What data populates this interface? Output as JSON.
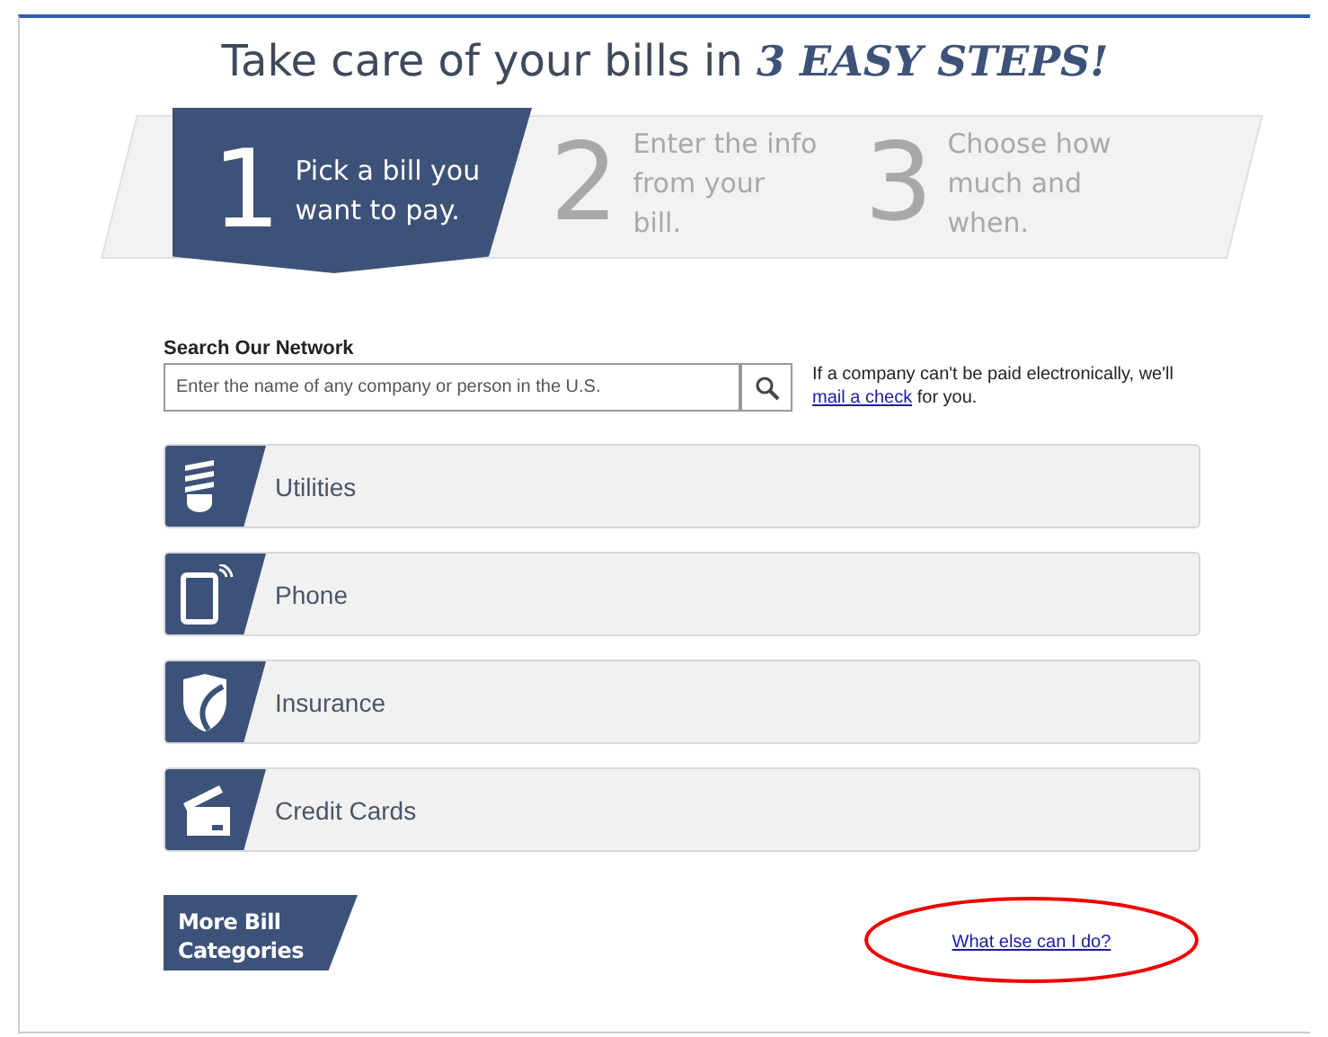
{
  "heading": {
    "text": "Take care of your bills in",
    "highlight": "3 EASY STEPS!"
  },
  "steps": [
    {
      "number": "1",
      "text": "Pick a bill you want to pay.",
      "selected": true
    },
    {
      "number": "2",
      "text": "Enter the info from your bill.",
      "selected": false
    },
    {
      "number": "3",
      "text": "Choose how much and when.",
      "selected": false
    }
  ],
  "search": {
    "label": "Search Our Network",
    "placeholder": "Enter the name of any company or person in the U.S."
  },
  "note": {
    "text": "If a company can't be paid electronically, we'll",
    "link": "mail a check",
    "after": "for you."
  },
  "categories": [
    {
      "label": "Utilities",
      "kind": "bulb"
    },
    {
      "label": "Phone",
      "kind": "tablet"
    },
    {
      "label": "Insurance",
      "kind": "shield"
    },
    {
      "label": "Credit Cards",
      "kind": "card"
    }
  ],
  "more_button": "More Bill Categories",
  "help_link": {
    "text": "What else can I do?",
    "circled": true
  }
}
